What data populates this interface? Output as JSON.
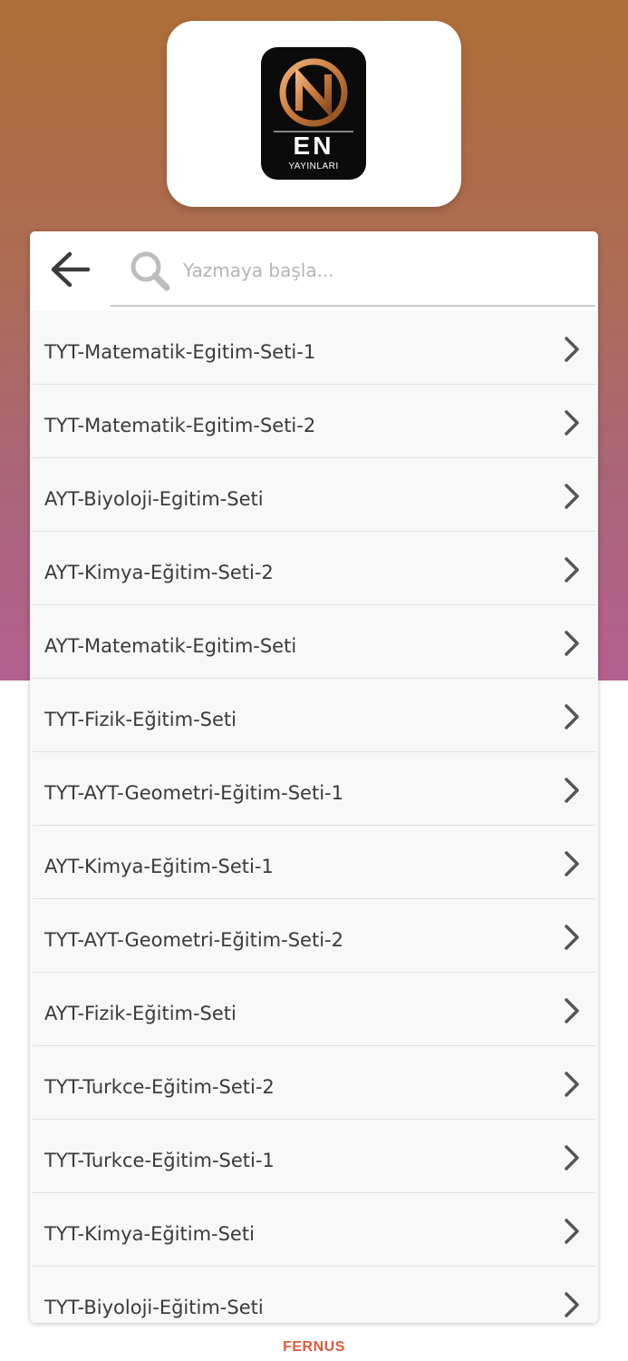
{
  "logo": {
    "main_text": "EN",
    "sub_text": "YAYINLARI",
    "icon": "en-yayinlari-logo"
  },
  "search": {
    "placeholder": "Yazmaya başla...",
    "value": "",
    "back_icon": "arrow-left-icon",
    "search_icon": "search-icon"
  },
  "items": [
    {
      "label": "TYT-Matematik-Egitim-Seti-1"
    },
    {
      "label": "TYT-Matematik-Egitim-Seti-2"
    },
    {
      "label": "AYT-Biyoloji-Egitim-Seti"
    },
    {
      "label": "AYT-Kimya-Eğitim-Seti-2"
    },
    {
      "label": "AYT-Matematik-Egitim-Seti"
    },
    {
      "label": "TYT-Fizik-Eğitim-Seti"
    },
    {
      "label": "TYT-AYT-Geometri-Eğitim-Seti-1"
    },
    {
      "label": "AYT-Kimya-Eğitim-Seti-1"
    },
    {
      "label": "TYT-AYT-Geometri-Eğitim-Seti-2"
    },
    {
      "label": "AYT-Fizik-Eğitim-Seti"
    },
    {
      "label": "TYT-Turkce-Eğitim-Seti-2"
    },
    {
      "label": "TYT-Turkce-Eğitim-Seti-1"
    },
    {
      "label": "TYT-Kimya-Eğitim-Seti"
    },
    {
      "label": "TYT-Biyoloji-Eğitim-Seti"
    }
  ],
  "footer": {
    "brand": "FERNUS"
  },
  "colors": {
    "gradient_top": "#ad6e37",
    "gradient_bottom": "#b4608f",
    "footer_brand": "#e05a3a"
  }
}
